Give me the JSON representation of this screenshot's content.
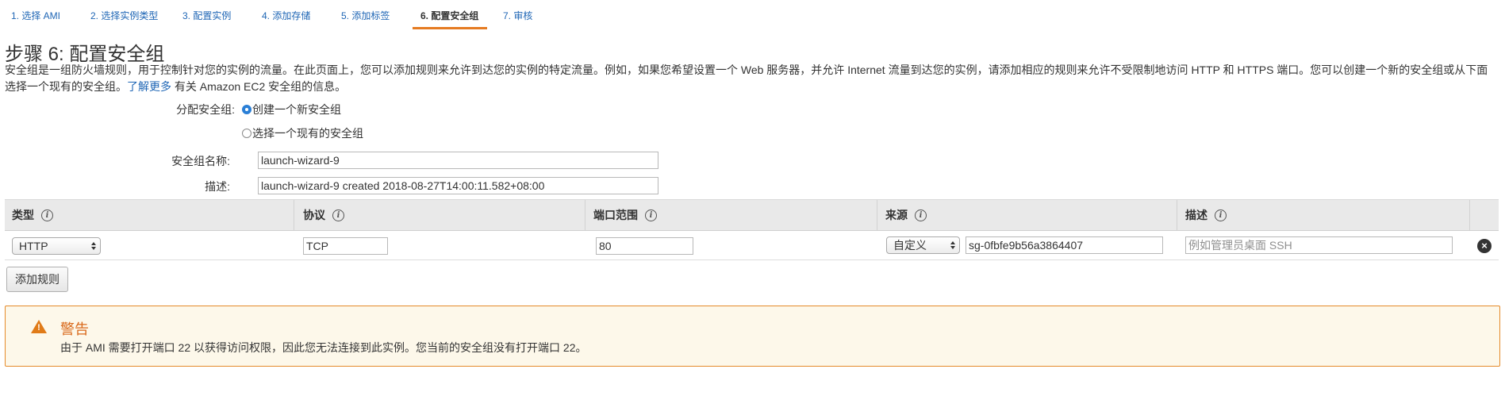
{
  "tabs": [
    {
      "label": "1. 选择 AMI"
    },
    {
      "label": "2. 选择实例类型"
    },
    {
      "label": "3. 配置实例"
    },
    {
      "label": "4. 添加存储"
    },
    {
      "label": "5. 添加标签"
    },
    {
      "label": "6. 配置安全组",
      "active": true
    },
    {
      "label": "7. 审核"
    }
  ],
  "page": {
    "title": "步骤 6: 配置安全组",
    "intro": "安全组是一组防火墙规则，用于控制针对您的实例的流量。在此页面上，您可以添加规则来允许到达您的实例的特定流量。例如，如果您希望设置一个 Web 服务器，并允许 Internet 流量到达您的实例，请添加相应的规则来允许不受限制地访问 HTTP 和 HTTPS 端口。您可以创建一个新的安全组或从下面选择一个现有的安全组。",
    "learn_more": "了解更多",
    "intro_tail": "有关 Amazon EC2 安全组的信息。"
  },
  "form": {
    "assign_label": "分配安全组:",
    "option_new": "创建一个新安全组",
    "option_existing": "选择一个现有的安全组",
    "name_label": "安全组名称:",
    "name_value": "launch-wizard-9",
    "desc_label": "描述:",
    "desc_value": "launch-wizard-9 created 2018-08-27T14:00:11.582+08:00"
  },
  "table": {
    "headers": {
      "type": "类型",
      "protocol": "协议",
      "port": "端口范围",
      "source": "来源",
      "description": "描述"
    },
    "rows": [
      {
        "type": "HTTP",
        "protocol": "TCP",
        "port": "80",
        "source_mode": "自定义",
        "source_value": "sg-0fbfe9b56a3864407",
        "description_placeholder": "例如管理员桌面 SSH"
      }
    ]
  },
  "add_rule_button": "添加规则",
  "warning": {
    "title": "警告",
    "text": "由于 AMI 需要打开端口 22 以获得访问权限，因此您无法连接到此实例。您当前的安全组没有打开端口 22。"
  },
  "colors": {
    "link": "#1f66b5",
    "active_tab_underline": "#e57b22",
    "warning_border": "#e58a2a",
    "warning_bg": "#fdf8ea",
    "warning_title": "#d9691a",
    "radio_selected": "#2a7fd6"
  },
  "icons": [
    "info-icon",
    "remove-rule-icon",
    "warning-icon",
    "select-arrows-icon"
  ]
}
